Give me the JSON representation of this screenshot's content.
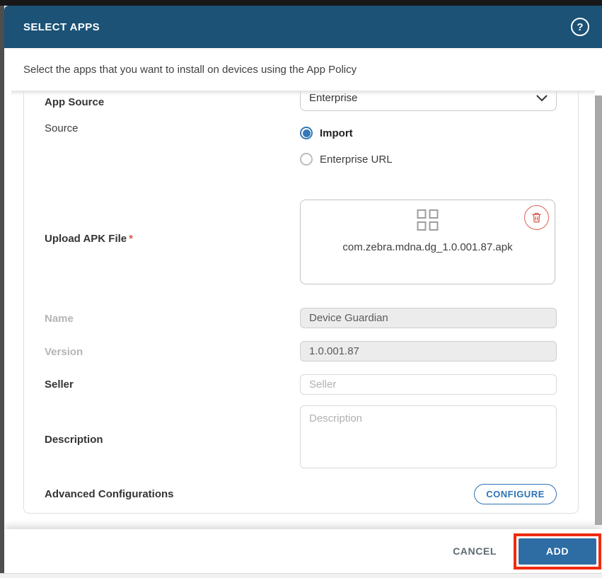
{
  "header": {
    "title": "SELECT APPS",
    "help_glyph": "?",
    "subtitle": "Select the apps that you want to install on devices using the App Policy"
  },
  "form": {
    "app_source": {
      "label": "App Source",
      "value": "Enterprise"
    },
    "source": {
      "label": "Source",
      "options": [
        {
          "label": "Import",
          "selected": true
        },
        {
          "label": "Enterprise URL",
          "selected": false
        }
      ]
    },
    "upload": {
      "label": "Upload APK File",
      "required_mark": "*",
      "file_name": "com.zebra.mdna.dg_1.0.001.87.apk"
    },
    "name": {
      "label": "Name",
      "value": "Device Guardian"
    },
    "version": {
      "label": "Version",
      "value": "1.0.001.87"
    },
    "seller": {
      "label": "Seller",
      "placeholder": "Seller",
      "value": ""
    },
    "description": {
      "label": "Description",
      "placeholder": "Description",
      "value": ""
    },
    "advanced": {
      "label": "Advanced Configurations",
      "button_label": "CONFIGURE"
    }
  },
  "footer": {
    "cancel_label": "CANCEL",
    "add_label": "ADD"
  },
  "colors": {
    "header_bg": "#1b5276",
    "accent_blue": "#2d73b6",
    "radio_blue": "#3578b5",
    "add_button_bg": "#2e6da4",
    "highlight_red": "#ee2b10",
    "danger_red": "#d9534a"
  }
}
